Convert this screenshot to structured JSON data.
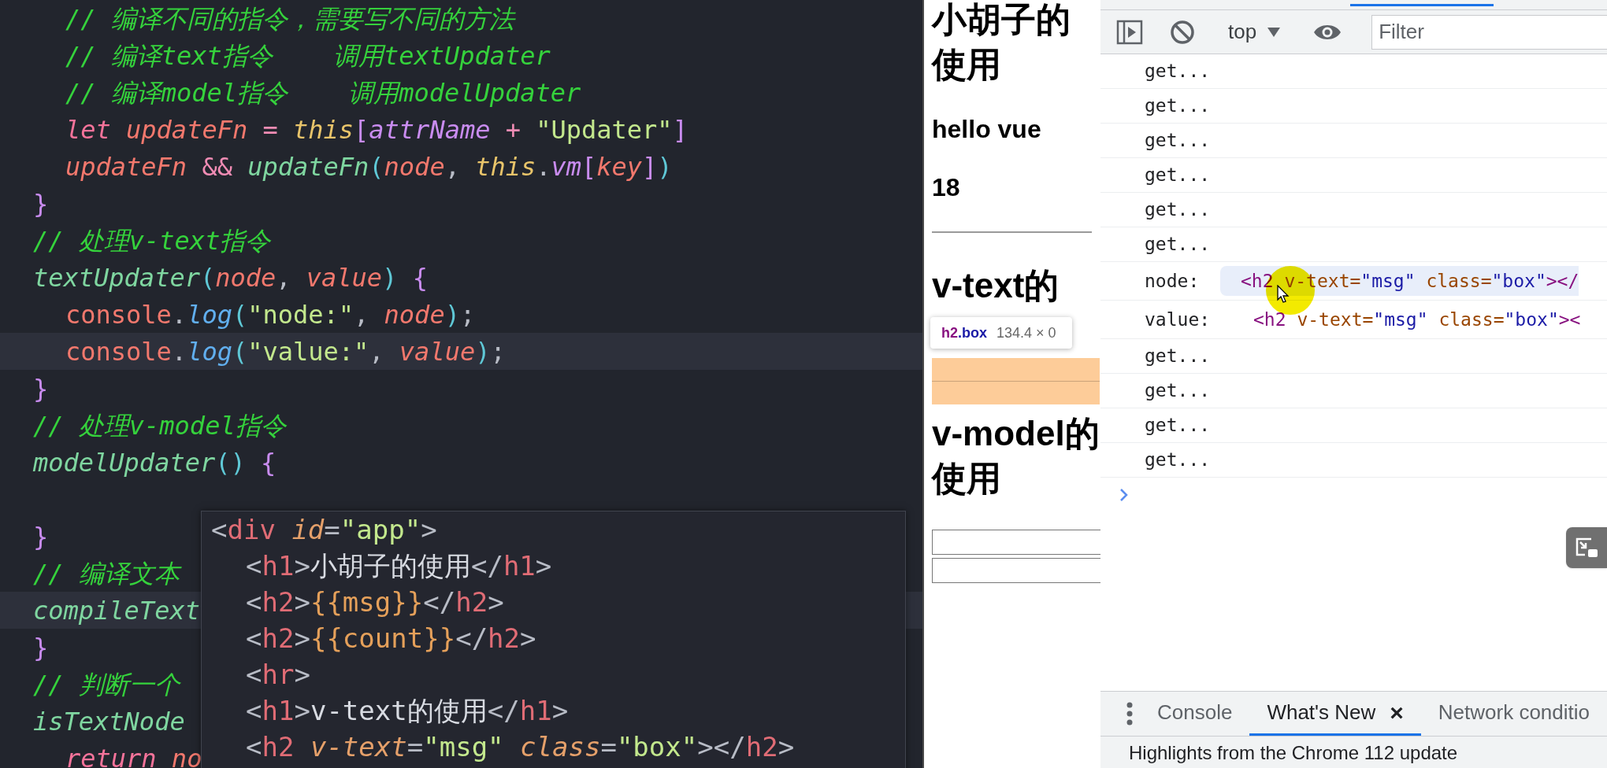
{
  "editor": {
    "lines": [
      {
        "indented": true,
        "highlighted": false,
        "tokens": [
          {
            "kind": "comment",
            "text": "// 编译不同的指令，需要写不同的方法"
          }
        ]
      },
      {
        "indented": true,
        "highlighted": false,
        "tokens": [
          {
            "kind": "comment",
            "text": "// 编译text指令    调用textUpdater"
          }
        ]
      },
      {
        "indented": true,
        "highlighted": false,
        "tokens": [
          {
            "kind": "comment",
            "text": "// 编译model指令    调用modelUpdater"
          }
        ]
      },
      {
        "indented": true,
        "highlighted": false,
        "tokens": [
          {
            "kind": "kw",
            "text": "let "
          },
          {
            "kind": "var",
            "text": "updateFn"
          },
          {
            "kind": "op",
            "text": " = "
          },
          {
            "kind": "this",
            "text": "this"
          },
          {
            "kind": "bracket",
            "text": "["
          },
          {
            "kind": "prop",
            "text": "attrName"
          },
          {
            "kind": "op",
            "text": " + "
          },
          {
            "kind": "string",
            "text": "\"Updater\""
          },
          {
            "kind": "bracket",
            "text": "]"
          }
        ]
      },
      {
        "indented": true,
        "highlighted": false,
        "tokens": [
          {
            "kind": "var",
            "text": "updateFn"
          },
          {
            "kind": "op",
            "text": " && "
          },
          {
            "kind": "func",
            "text": "updateFn"
          },
          {
            "kind": "paren",
            "text": "("
          },
          {
            "kind": "var",
            "text": "node"
          },
          {
            "kind": "punct",
            "text": ", "
          },
          {
            "kind": "this",
            "text": "this"
          },
          {
            "kind": "punct",
            "text": "."
          },
          {
            "kind": "prop",
            "text": "vm"
          },
          {
            "kind": "bracket",
            "text": "["
          },
          {
            "kind": "var",
            "text": "key"
          },
          {
            "kind": "bracket",
            "text": "]"
          },
          {
            "kind": "paren",
            "text": ")"
          }
        ]
      },
      {
        "indented": false,
        "highlighted": false,
        "tokens": [
          {
            "kind": "bracket",
            "text": "}"
          }
        ]
      },
      {
        "indented": false,
        "highlighted": false,
        "tokens": [
          {
            "kind": "comment",
            "text": "// 处理v-text指令"
          }
        ]
      },
      {
        "indented": false,
        "highlighted": false,
        "tokens": [
          {
            "kind": "func",
            "text": "textUpdater"
          },
          {
            "kind": "paren",
            "text": "("
          },
          {
            "kind": "var",
            "text": "node"
          },
          {
            "kind": "punct",
            "text": ", "
          },
          {
            "kind": "var",
            "text": "value"
          },
          {
            "kind": "paren",
            "text": ")"
          },
          {
            "kind": "bracket",
            "text": " {"
          }
        ]
      },
      {
        "indented": true,
        "highlighted": false,
        "tokens": [
          {
            "kind": "obj",
            "text": "console"
          },
          {
            "kind": "punct",
            "text": "."
          },
          {
            "kind": "method",
            "text": "log"
          },
          {
            "kind": "paren",
            "text": "("
          },
          {
            "kind": "string",
            "text": "\"node:\""
          },
          {
            "kind": "punct",
            "text": ", "
          },
          {
            "kind": "var",
            "text": "node"
          },
          {
            "kind": "paren",
            "text": ")"
          },
          {
            "kind": "punct",
            "text": ";"
          }
        ]
      },
      {
        "indented": true,
        "highlighted": true,
        "tokens": [
          {
            "kind": "obj",
            "text": "console"
          },
          {
            "kind": "punct",
            "text": "."
          },
          {
            "kind": "method",
            "text": "log"
          },
          {
            "kind": "paren",
            "text": "("
          },
          {
            "kind": "string",
            "text": "\"value:\""
          },
          {
            "kind": "punct",
            "text": ", "
          },
          {
            "kind": "var",
            "text": "value"
          },
          {
            "kind": "paren",
            "text": ")"
          },
          {
            "kind": "punct",
            "text": ";"
          }
        ]
      },
      {
        "indented": false,
        "highlighted": false,
        "tokens": [
          {
            "kind": "bracket",
            "text": "}"
          }
        ]
      },
      {
        "indented": false,
        "highlighted": false,
        "tokens": [
          {
            "kind": "comment",
            "text": "// 处理v-model指令"
          }
        ]
      },
      {
        "indented": false,
        "highlighted": false,
        "tokens": [
          {
            "kind": "func",
            "text": "modelUpdater"
          },
          {
            "kind": "paren",
            "text": "()"
          },
          {
            "kind": "bracket",
            "text": " {"
          }
        ]
      },
      {
        "highlighted": false
      },
      {
        "indented": false,
        "highlighted": false,
        "tokens": [
          {
            "kind": "bracket",
            "text": "}"
          }
        ]
      },
      {
        "indented": false,
        "highlighted": false,
        "tokens": [
          {
            "kind": "comment",
            "text": "// 编译文本"
          }
        ]
      },
      {
        "indented": false,
        "highlighted": true,
        "tokens": [
          {
            "kind": "func",
            "text": "compileText"
          }
        ]
      },
      {
        "indented": false,
        "highlighted": false,
        "tokens": [
          {
            "kind": "bracket",
            "text": "}"
          }
        ]
      },
      {
        "indented": false,
        "highlighted": false,
        "tokens": [
          {
            "kind": "comment",
            "text": "// 判断一个"
          }
        ]
      },
      {
        "indented": false,
        "highlighted": false,
        "tokens": [
          {
            "kind": "func",
            "text": "isTextNode"
          }
        ]
      },
      {
        "indented": true,
        "highlighted": false,
        "tokens": [
          {
            "kind": "kw",
            "text": "return "
          },
          {
            "kind": "var",
            "text": "no"
          }
        ]
      }
    ]
  },
  "hover_popup": {
    "lines": [
      {
        "indented": false,
        "tokens": [
          {
            "kind": "punct",
            "text": "<"
          },
          {
            "kind": "tag",
            "text": "div"
          },
          {
            "kind": "attr",
            "text": " id"
          },
          {
            "kind": "punct",
            "text": "="
          },
          {
            "kind": "string",
            "text": "\"app\""
          },
          {
            "kind": "punct",
            "text": ">"
          }
        ]
      },
      {
        "indented": true,
        "tokens": [
          {
            "kind": "punct",
            "text": "<"
          },
          {
            "kind": "tag",
            "text": "h1"
          },
          {
            "kind": "punct",
            "text": ">"
          },
          {
            "kind": "text",
            "text": "小胡子的使用"
          },
          {
            "kind": "punct",
            "text": "</"
          },
          {
            "kind": "tag",
            "text": "h1"
          },
          {
            "kind": "punct",
            "text": ">"
          }
        ]
      },
      {
        "indented": true,
        "tokens": [
          {
            "kind": "punct",
            "text": "<"
          },
          {
            "kind": "tag",
            "text": "h2"
          },
          {
            "kind": "punct",
            "text": ">"
          },
          {
            "kind": "mustache",
            "text": "{{msg}}"
          },
          {
            "kind": "punct",
            "text": "</"
          },
          {
            "kind": "tag",
            "text": "h2"
          },
          {
            "kind": "punct",
            "text": ">"
          }
        ]
      },
      {
        "indented": true,
        "tokens": [
          {
            "kind": "punct",
            "text": "<"
          },
          {
            "kind": "tag",
            "text": "h2"
          },
          {
            "kind": "punct",
            "text": ">"
          },
          {
            "kind": "mustache",
            "text": "{{count}}"
          },
          {
            "kind": "punct",
            "text": "</"
          },
          {
            "kind": "tag",
            "text": "h2"
          },
          {
            "kind": "punct",
            "text": ">"
          }
        ]
      },
      {
        "indented": true,
        "tokens": [
          {
            "kind": "punct",
            "text": "<"
          },
          {
            "kind": "tag",
            "text": "hr"
          },
          {
            "kind": "punct",
            "text": ">"
          }
        ]
      },
      {
        "indented": true,
        "tokens": [
          {
            "kind": "punct",
            "text": "<"
          },
          {
            "kind": "tag",
            "text": "h1"
          },
          {
            "kind": "punct",
            "text": ">"
          },
          {
            "kind": "text",
            "text": "v-text的使用"
          },
          {
            "kind": "punct",
            "text": "</"
          },
          {
            "kind": "tag",
            "text": "h1"
          },
          {
            "kind": "punct",
            "text": ">"
          }
        ]
      },
      {
        "indented": true,
        "tokens": [
          {
            "kind": "punct",
            "text": "<"
          },
          {
            "kind": "tag",
            "text": "h2"
          },
          {
            "kind": "attr",
            "text": " v-text"
          },
          {
            "kind": "punct",
            "text": "="
          },
          {
            "kind": "string",
            "text": "\"msg\""
          },
          {
            "kind": "attr",
            "text": " class"
          },
          {
            "kind": "punct",
            "text": "="
          },
          {
            "kind": "string",
            "text": "\"box\""
          },
          {
            "kind": "punct",
            "text": "></"
          },
          {
            "kind": "tag",
            "text": "h2"
          },
          {
            "kind": "punct",
            "text": ">"
          }
        ]
      }
    ]
  },
  "page_preview": {
    "elements": [
      {
        "kind": "h1",
        "text": "小胡子的使用"
      },
      {
        "kind": "h2",
        "text": "hello vue"
      },
      {
        "kind": "h2",
        "text": "18"
      },
      {
        "kind": "hr"
      },
      {
        "kind": "h1",
        "text": "v-text的"
      },
      {
        "kind": "box"
      },
      {
        "kind": "h1",
        "text": "v-model的使用"
      },
      {
        "kind": "input"
      },
      {
        "kind": "input"
      }
    ],
    "inspect_tooltip": {
      "tag": "h2",
      "class_name": ".box",
      "size": "134.4 × 0"
    }
  },
  "devtools": {
    "context": "top",
    "filter_placeholder": "Filter",
    "messages": [
      {
        "kind": "log",
        "text": "get..."
      },
      {
        "kind": "log",
        "text": "get..."
      },
      {
        "kind": "log",
        "text": "get..."
      },
      {
        "kind": "log",
        "text": "get..."
      },
      {
        "kind": "log",
        "text": "get..."
      },
      {
        "kind": "log",
        "text": "get..."
      },
      {
        "kind": "element",
        "label": "node:",
        "hovered": true,
        "tokens": [
          {
            "kind": "tag",
            "text": "<h2"
          },
          {
            "kind": "attr",
            "text": " v-text="
          },
          {
            "kind": "value",
            "text": "\"msg\""
          },
          {
            "kind": "attr",
            "text": " class="
          },
          {
            "kind": "value",
            "text": "\"box\""
          },
          {
            "kind": "tag",
            "text": "></"
          }
        ]
      },
      {
        "kind": "element",
        "label": "value:",
        "hovered": false,
        "tokens": [
          {
            "kind": "tag",
            "text": "<h2"
          },
          {
            "kind": "attr",
            "text": " v-text="
          },
          {
            "kind": "value",
            "text": "\"msg\""
          },
          {
            "kind": "attr",
            "text": " class="
          },
          {
            "kind": "value",
            "text": "\"box\""
          },
          {
            "kind": "tag",
            "text": "><"
          }
        ]
      },
      {
        "kind": "log",
        "text": "get..."
      },
      {
        "kind": "log",
        "text": "get..."
      },
      {
        "kind": "log",
        "text": "get..."
      },
      {
        "kind": "log",
        "text": "get..."
      }
    ],
    "drawer": {
      "tabs": [
        {
          "label": "Console",
          "selected": false
        },
        {
          "label": "What's New",
          "selected": true,
          "close": "×"
        },
        {
          "label": "Network conditio",
          "selected": false
        }
      ],
      "headline": "Highlights from the Chrome 112 update"
    }
  }
}
